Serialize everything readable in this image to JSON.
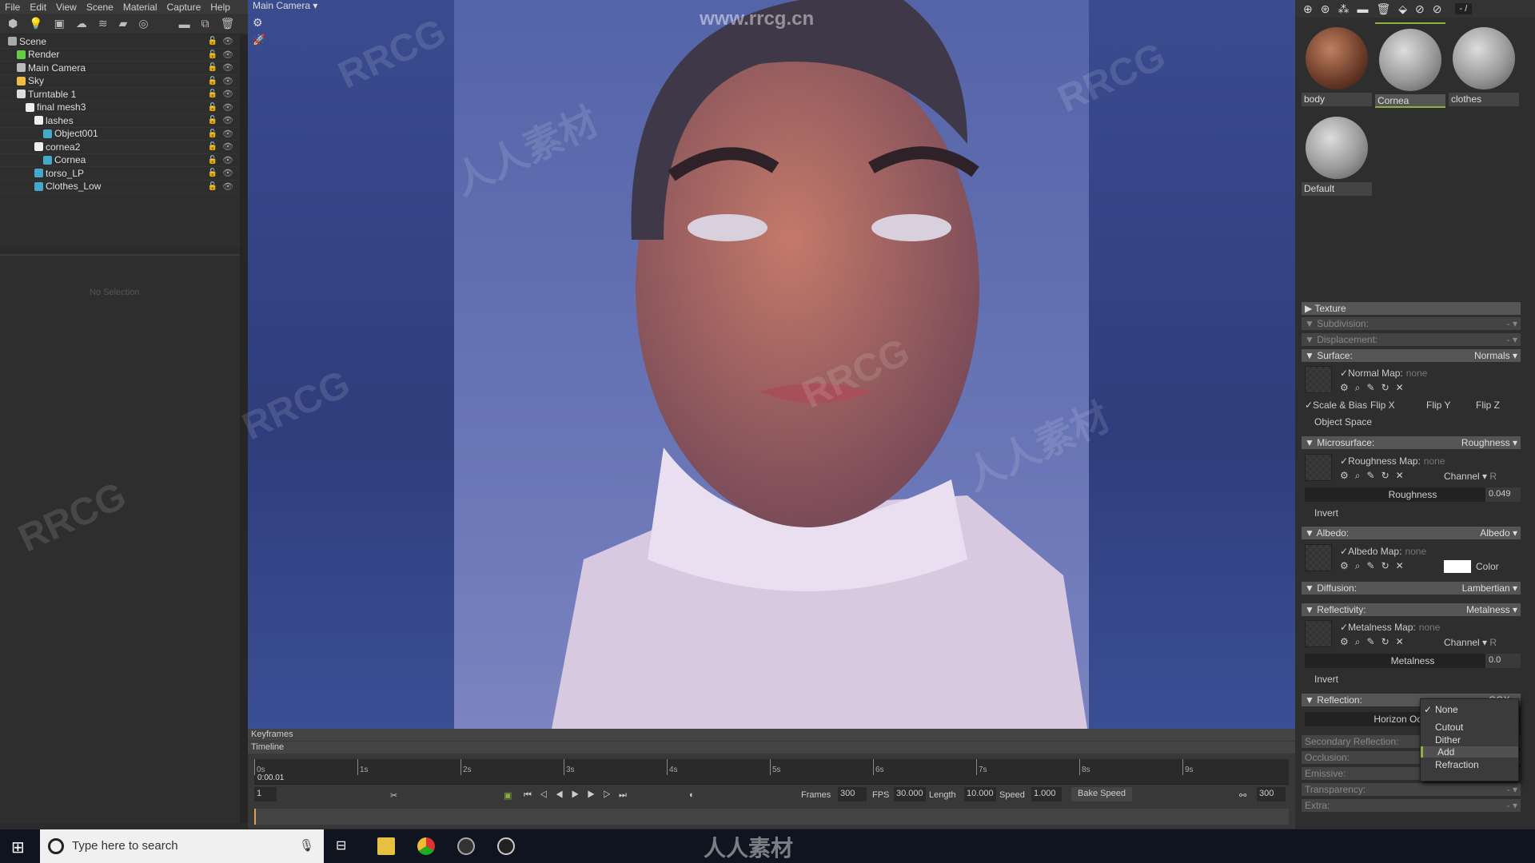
{
  "menu": [
    "File",
    "Edit",
    "View",
    "Scene",
    "Material",
    "Capture",
    "Help"
  ],
  "scene_tree": [
    {
      "label": "Scene",
      "indent": 0,
      "icon": "scene-icon"
    },
    {
      "label": "Render",
      "indent": 1,
      "icon": "render-gear-icon"
    },
    {
      "label": "Main Camera",
      "indent": 1,
      "icon": "camera-icon"
    },
    {
      "label": "Sky",
      "indent": 1,
      "icon": "sky-icon"
    },
    {
      "label": "Turntable 1",
      "indent": 1,
      "icon": "turntable-icon"
    },
    {
      "label": "final mesh3",
      "indent": 2,
      "icon": "mesh-icon"
    },
    {
      "label": "lashes",
      "indent": 3,
      "icon": "mesh-icon"
    },
    {
      "label": "Object001",
      "indent": 4,
      "icon": "cube-icon"
    },
    {
      "label": "cornea2",
      "indent": 3,
      "icon": "mesh-icon"
    },
    {
      "label": "Cornea",
      "indent": 4,
      "icon": "cube-icon"
    },
    {
      "label": "torso_LP",
      "indent": 3,
      "icon": "cube-icon"
    },
    {
      "label": "Clothes_Low",
      "indent": 3,
      "icon": "cube-icon"
    }
  ],
  "no_selection": "No Selection",
  "viewport": {
    "camera": "Main Camera",
    "watermark_top": "www.rrcg.cn",
    "watermark_bottom": "人人素材",
    "watermark": "RRCG"
  },
  "timeline": {
    "keyframes": "Keyframes",
    "timeline": "Timeline",
    "ticks": [
      "0s",
      "1s",
      "2s",
      "3s",
      "4s",
      "5s",
      "6s",
      "7s",
      "8s",
      "9s"
    ],
    "current_time": "0:00.01",
    "frame": "1",
    "frames_label": "Frames",
    "frames": "300",
    "fps_label": "FPS",
    "fps": "30.000",
    "length_label": "Length",
    "length": "10.000",
    "speed_label": "Speed",
    "speed": "1.000",
    "bake_speed": "Bake Speed",
    "end_frame": "300"
  },
  "materials": {
    "page": "- /",
    "items": [
      {
        "name": "body"
      },
      {
        "name": "Cornea",
        "selected": true
      },
      {
        "name": "clothes"
      },
      {
        "name": "Default"
      }
    ],
    "accent": "#8fb040"
  },
  "props": {
    "texture": "Texture",
    "subdivision": "Subdivision:",
    "displacement": "Displacement:",
    "dash": "-",
    "surface": "Surface:",
    "surface_val": "Normals",
    "normal_map": "Normal Map:",
    "none": "none",
    "scale_bias": "Scale & Bias",
    "flip_x": "Flip X",
    "flip_y": "Flip Y",
    "flip_z": "Flip Z",
    "object_space": "Object Space",
    "microsurface": "Microsurface:",
    "microsurface_val": "Roughness",
    "roughness_map": "Roughness Map:",
    "channel": "Channel",
    "channel_val": "R",
    "roughness": "Roughness",
    "roughness_val": "0.049",
    "invert": "Invert",
    "albedo": "Albedo:",
    "albedo_val": "Albedo",
    "albedo_map": "Albedo Map:",
    "color": "Color",
    "diffusion": "Diffusion:",
    "diffusion_val": "Lambertian",
    "reflectivity": "Reflectivity:",
    "reflectivity_val": "Metalness",
    "metalness_map": "Metalness Map:",
    "metalness": "Metalness",
    "metalness_val": "0.0",
    "reflection": "Reflection:",
    "reflection_val": "GGX",
    "horizon": "Horizon Occlusion",
    "secondary": "Secondary Reflection:",
    "occlusion": "Occlusion:",
    "emissive": "Emissive:",
    "transparency": "Transparency:",
    "extra": "Extra:"
  },
  "dropdown": {
    "options": [
      "None",
      "Cutout",
      "Dither",
      "Add",
      "Refraction"
    ],
    "checked": "None",
    "hovered": "Add"
  },
  "taskbar": {
    "search_placeholder": "Type here to search"
  }
}
